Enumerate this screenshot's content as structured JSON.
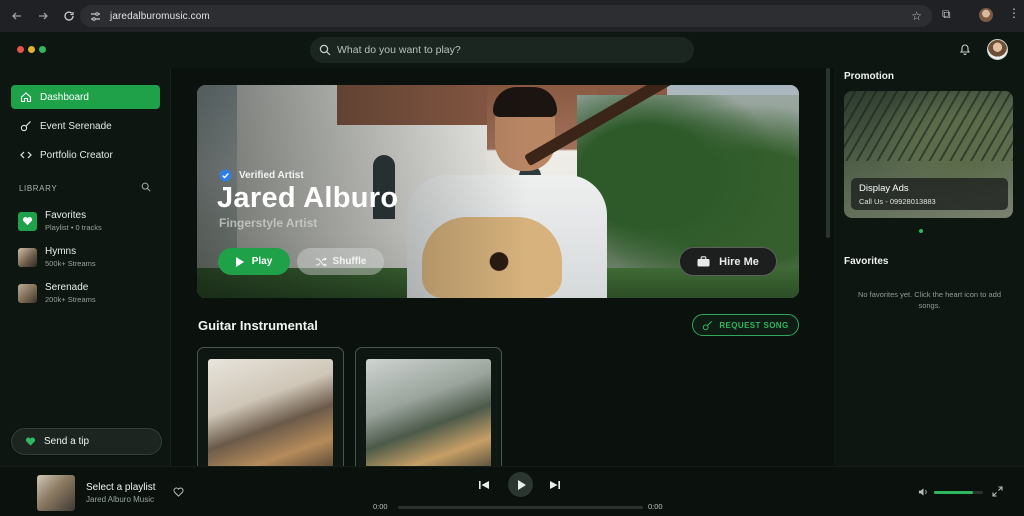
{
  "browser": {
    "url": "jaredalburomusic.com",
    "back_icon": "arrow-left-icon",
    "forward_icon": "arrow-right-icon",
    "reload_icon": "reload-icon"
  },
  "topbar": {
    "window_dots": [
      "#e5534b",
      "#e0b32c",
      "#2fb85f"
    ],
    "search_placeholder": "What do you want to play?"
  },
  "sidebar": {
    "nav": [
      {
        "label": "Dashboard",
        "icon": "home-icon",
        "active": true
      },
      {
        "label": "Event Serenade",
        "icon": "guitar-icon",
        "active": false
      },
      {
        "label": "Portfolio Creator",
        "icon": "code-icon",
        "active": false
      }
    ],
    "library_header": "LIBRARY",
    "library": [
      {
        "title": "Favorites",
        "subtitle": "Playlist • 0 tracks",
        "icon": "heart-icon"
      },
      {
        "title": "Hymns",
        "subtitle": "500k+ Streams",
        "icon": "hymns-thumbnail"
      },
      {
        "title": "Serenade",
        "subtitle": "200k+ Streams",
        "icon": "serenade-thumbnail"
      }
    ],
    "tip_label": "Send a tip"
  },
  "hero": {
    "badge": "Verified Artist",
    "artist": "Jared Alburo",
    "role": "Fingerstyle Artist",
    "play_label": "Play",
    "shuffle_label": "Shuffle",
    "hire_label": "Hire Me"
  },
  "section": {
    "title": "Guitar Instrumental",
    "request_label": "REQUEST SONG"
  },
  "right_panel": {
    "promotion_title": "Promotion",
    "ad_title": "Display Ads",
    "ad_subtitle": "Call Us - 09928013883",
    "favorites_title": "Favorites",
    "favorites_empty": "No favorites yet. Click the heart icon to add songs."
  },
  "player": {
    "title": "Select a playlist",
    "artist": "Jared Alburo Music",
    "current_time": "0:00",
    "duration": "0:00",
    "progress": 0,
    "volume": 0.8
  },
  "colors": {
    "accent": "#1fa14a",
    "background": "#0b120e"
  }
}
